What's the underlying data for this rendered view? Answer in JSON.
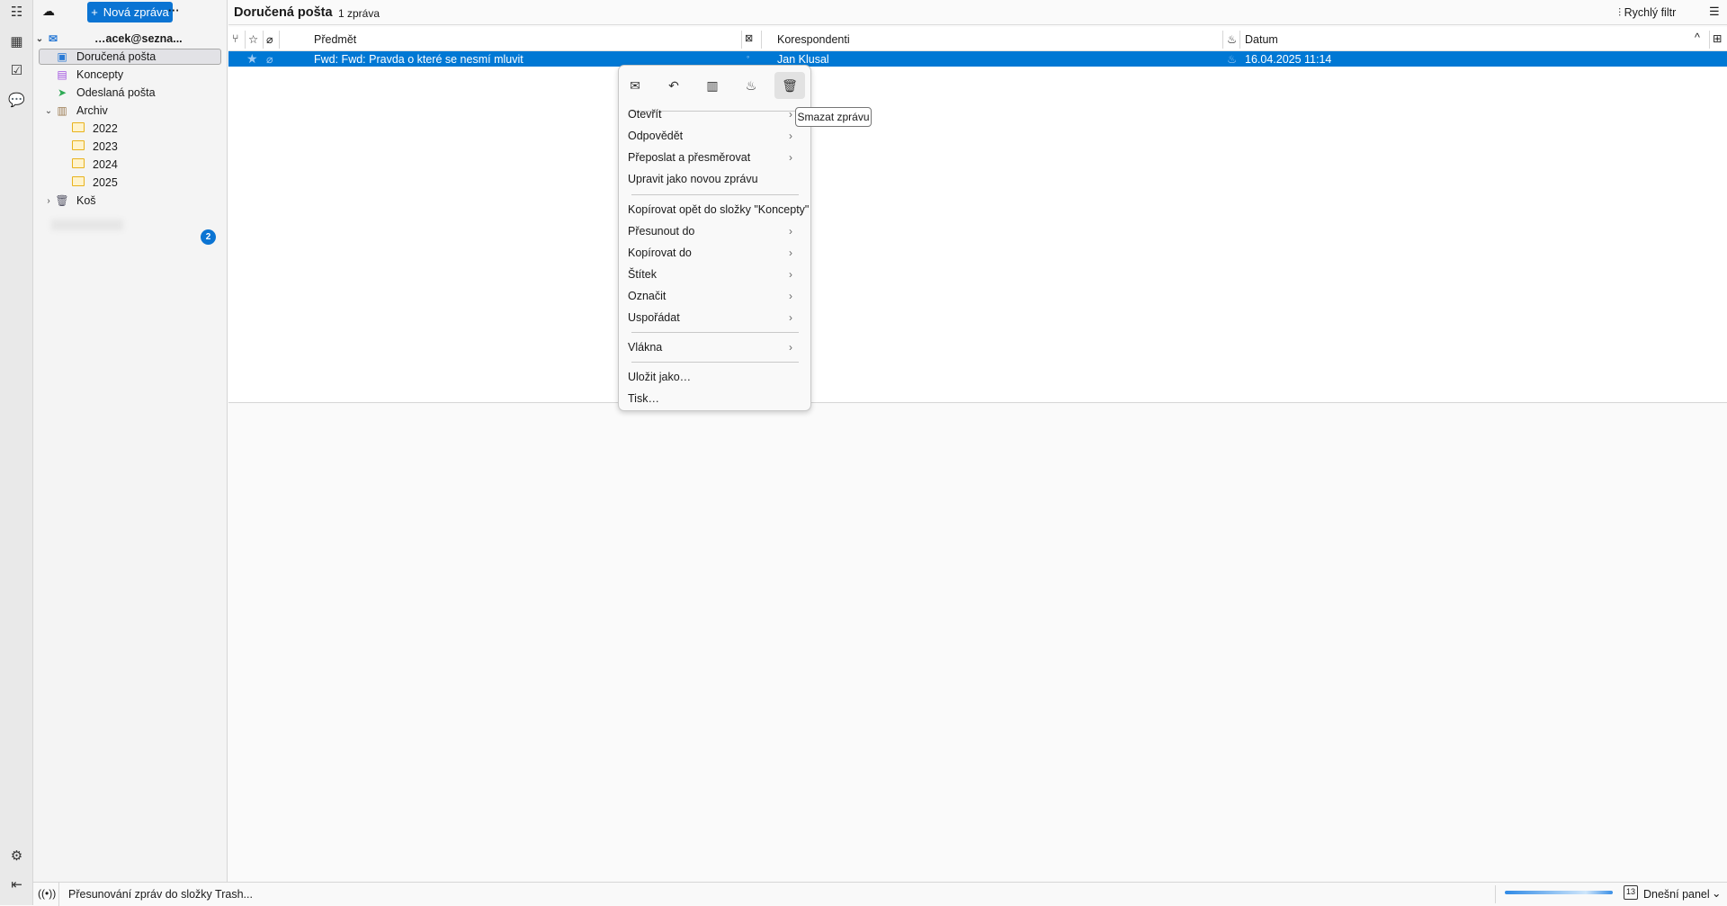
{
  "spaces": {
    "icons": [
      "address-book-icon",
      "calendar-icon",
      "tasks-icon",
      "chat-icon"
    ],
    "bottom_icons": [
      "settings-icon",
      "collapse-icon"
    ]
  },
  "folder_pane": {
    "new_message_label": "Nová zpráva",
    "more_label": "···",
    "account_label": "…acek@sezna...",
    "folders": [
      {
        "label": "Doručená pošta",
        "icon": "inbox-icon",
        "selected": true
      },
      {
        "label": "Koncepty",
        "icon": "drafts-icon"
      },
      {
        "label": "Odeslaná pošta",
        "icon": "sent-icon"
      },
      {
        "label": "Archiv",
        "icon": "archive-icon",
        "expanded": true
      },
      {
        "label": "2022",
        "icon": "folder-icon"
      },
      {
        "label": "2023",
        "icon": "folder-icon"
      },
      {
        "label": "2024",
        "icon": "folder-icon"
      },
      {
        "label": "2025",
        "icon": "folder-icon"
      },
      {
        "label": "Koš",
        "icon": "trash-icon",
        "expanded": false
      }
    ],
    "second_account_unread": "2"
  },
  "header": {
    "title": "Doručená pošta",
    "count": "1 zpráva",
    "quick_filter": "Rychlý filtr"
  },
  "columns": {
    "subject": "Předmět",
    "correspondents": "Korespondenti",
    "date": "Datum"
  },
  "messages": [
    {
      "subject": "Fwd: Fwd: Pravda o které se nesmí mluvit",
      "correspondent": "Jan Klusal",
      "date": "16.04.2025 11:14",
      "selected": true
    }
  ],
  "context_menu": {
    "toolbar": [
      "mark-icon",
      "reply-icon",
      "archive-icon",
      "junk-icon",
      "delete-icon"
    ],
    "items": [
      {
        "label": "Otevřít",
        "submenu": true
      },
      {
        "label": "Odpovědět",
        "submenu": true
      },
      {
        "label": "Přeposlat a přesměrovat",
        "submenu": true
      },
      {
        "label": "Upravit jako novou zprávu",
        "submenu": false
      },
      {
        "label": "Kopírovat opět do složky \"Koncepty\"",
        "submenu": false
      },
      {
        "label": "Přesunout do",
        "submenu": true
      },
      {
        "label": "Kopírovat do",
        "submenu": true
      },
      {
        "label": "Štítek",
        "submenu": true
      },
      {
        "label": "Označit",
        "submenu": true
      },
      {
        "label": "Uspořádat",
        "submenu": true
      },
      {
        "label": "Vlákna",
        "submenu": true
      },
      {
        "label": "Uložit jako…",
        "submenu": false
      },
      {
        "label": "Tisk…",
        "submenu": false
      }
    ],
    "tooltip": "Smazat zprávu"
  },
  "status": {
    "text": "Přesunování zpráv do složky Trash...",
    "today_pane": "Dnešní panel",
    "calendar_day": "13"
  }
}
